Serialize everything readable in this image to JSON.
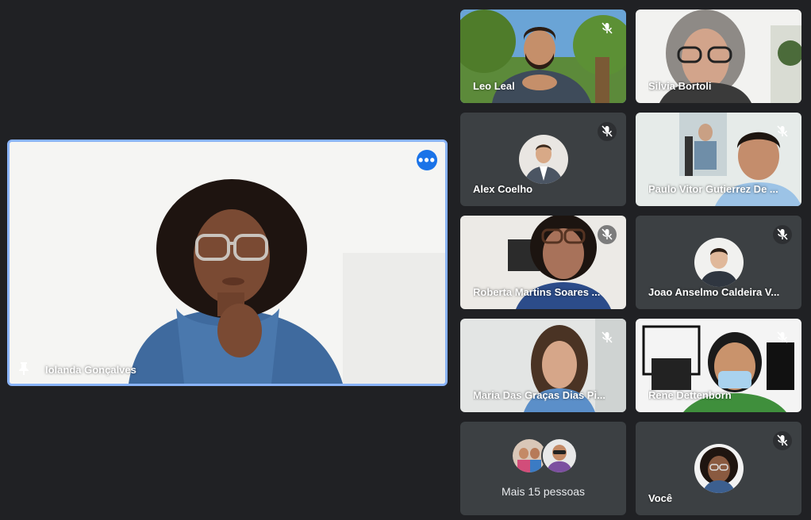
{
  "main_speaker": {
    "name": "Iolanda Gonçalves",
    "more_icon": "more-horizontal-icon",
    "pin_icon": "pin-icon"
  },
  "participants": [
    {
      "name": "Leo Leal",
      "muted": true
    },
    {
      "name": "Silvia Bortoli",
      "muted": false
    },
    {
      "name": "Alex Coelho",
      "muted": true
    },
    {
      "name": "Paulo Vitor Gutierrez De ...",
      "muted": true
    },
    {
      "name": "Roberta Martins Soares ...",
      "muted": true
    },
    {
      "name": "Joao Anselmo Caldeira V...",
      "muted": true
    },
    {
      "name": "Maria Das Graças Dias Pi...",
      "muted": true
    },
    {
      "name": "Rene Dettenborn",
      "muted": true
    },
    {
      "name": "Você",
      "muted": true
    }
  ],
  "more_people": {
    "label": "Mais 15 pessoas"
  },
  "colors": {
    "background": "#202124",
    "tile": "#3c4043",
    "active_border": "#8ab4f8",
    "accent": "#1a73e8"
  }
}
